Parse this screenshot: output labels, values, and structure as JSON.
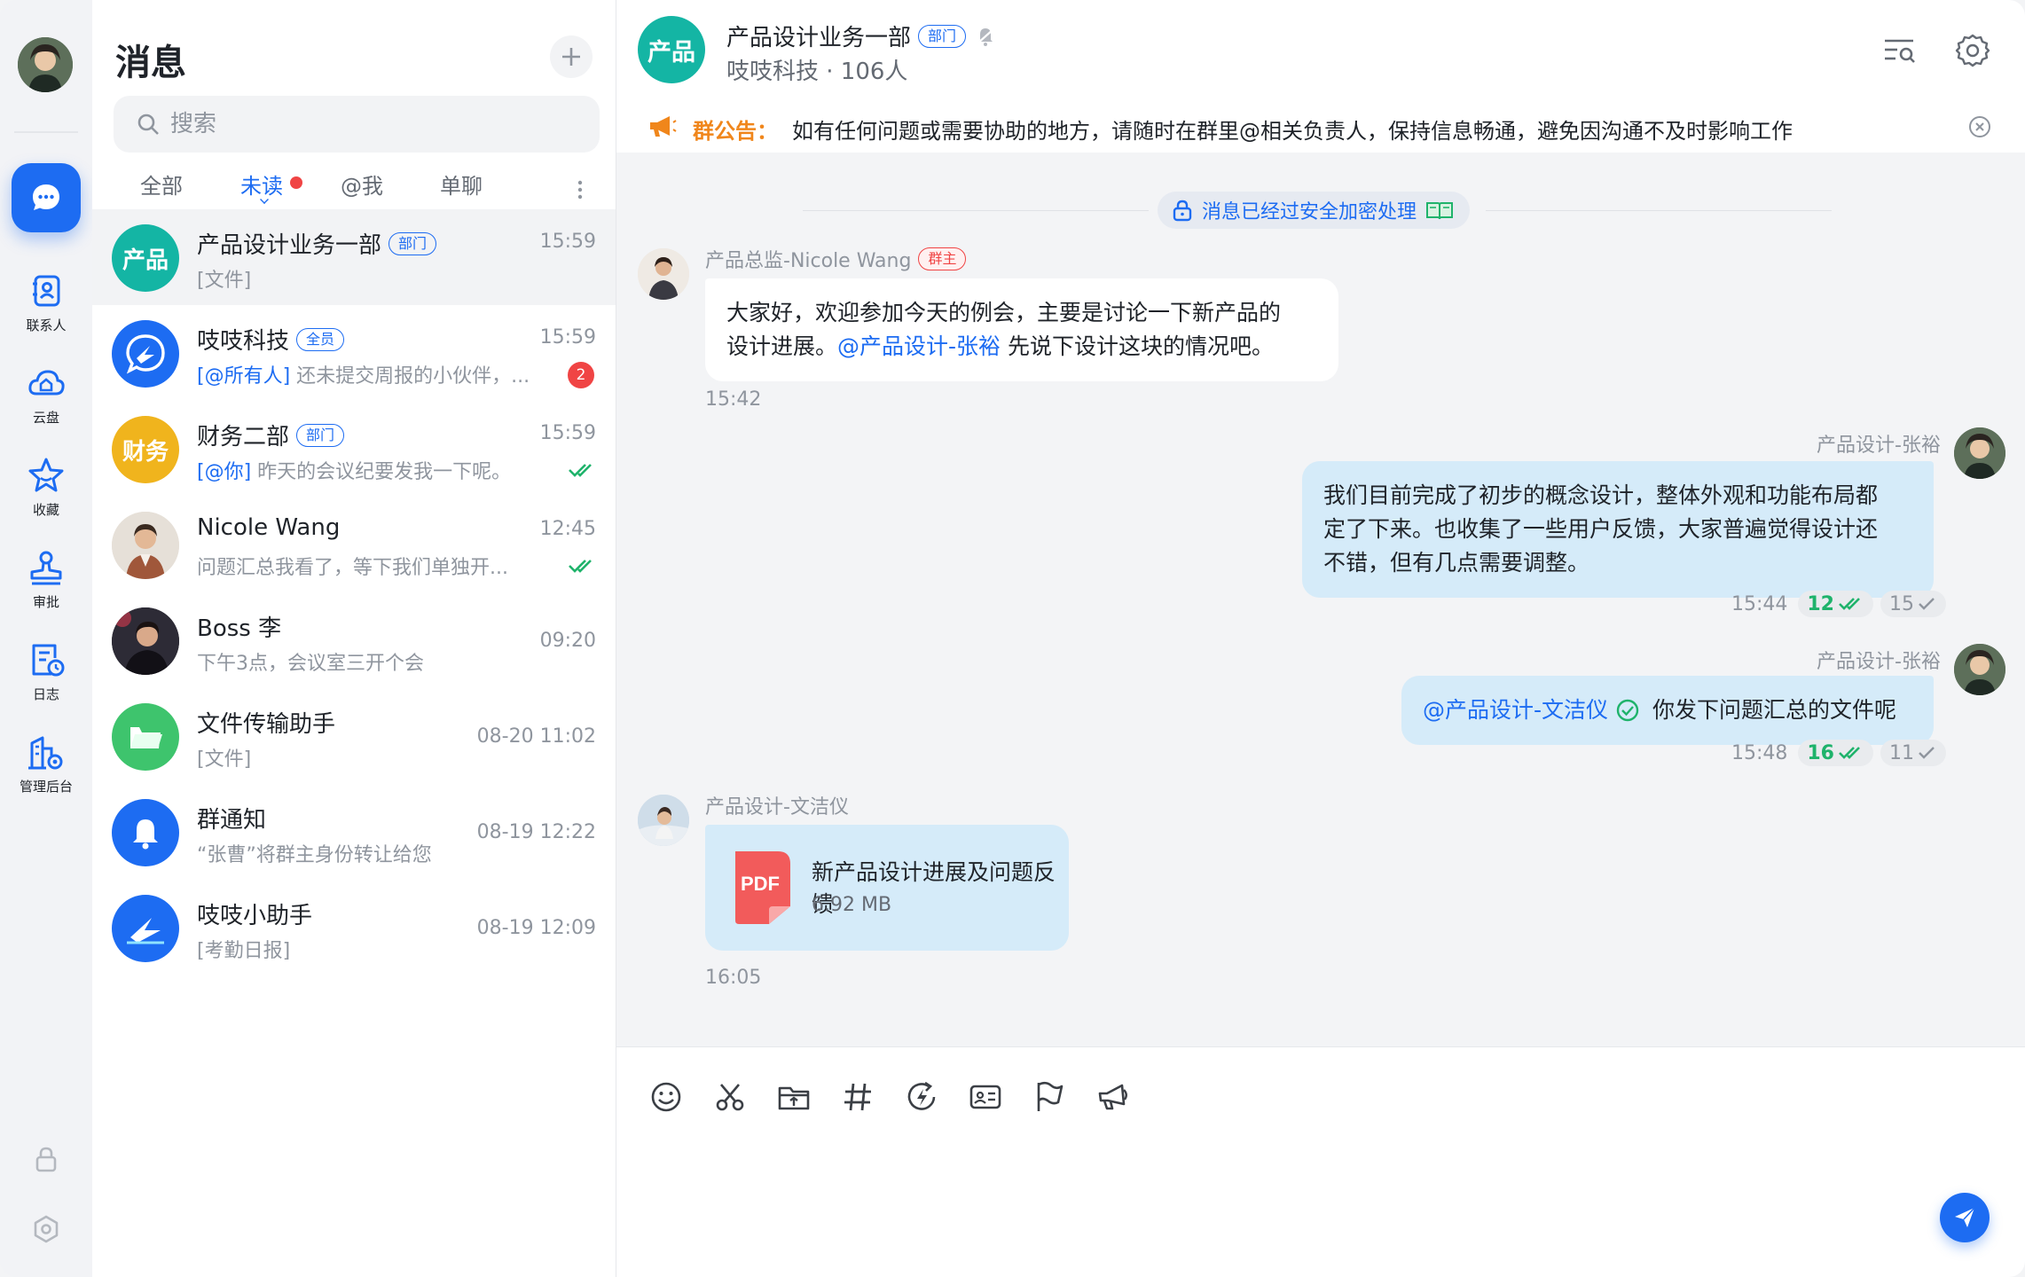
{
  "nav": {
    "items": [
      {
        "label": "联系人",
        "icon": "contacts-icon"
      },
      {
        "label": "云盘",
        "icon": "cloud-drive-icon"
      },
      {
        "label": "收藏",
        "icon": "star-icon"
      },
      {
        "label": "审批",
        "icon": "stamp-icon"
      },
      {
        "label": "日志",
        "icon": "log-icon"
      },
      {
        "label": "管理后台",
        "icon": "admin-icon"
      }
    ]
  },
  "list": {
    "title": "消息",
    "search_placeholder": "搜索",
    "tabs": [
      "全部",
      "未读",
      "@我",
      "单聊"
    ],
    "conversations": [
      {
        "name": "产品设计业务一部",
        "tag": "部门",
        "avatar_text": "产品",
        "avatar_color": "#14b5a4",
        "preview": "[文件]",
        "time": "15:59"
      },
      {
        "name": "吱吱科技",
        "tag": "全员",
        "avatar_color": "#1d6cf2",
        "preview_mention": "[@所有人]",
        "preview": "还未提交周报的小伙伴，...",
        "time": "15:59",
        "badge": "2"
      },
      {
        "name": "财务二部",
        "tag": "部门",
        "avatar_text": "财务",
        "avatar_color": "#f0b41d",
        "preview_mention": "[@你]",
        "preview": "昨天的会议纪要发我一下呢。",
        "time": "15:59"
      },
      {
        "name": "Nicole Wang",
        "preview": "问题汇总我看了，等下我们单独开...",
        "time": "12:45"
      },
      {
        "name": "Boss 李",
        "preview": "下午3点，会议室三开个会",
        "time": "09:20"
      },
      {
        "name": "文件传输助手",
        "avatar_color": "#3ec46d",
        "preview": "[文件]",
        "time": "08-20 11:02"
      },
      {
        "name": "群通知",
        "avatar_color": "#1d6cf2",
        "preview": "“张曹”将群主身份转让给您",
        "time": "08-19 12:22"
      },
      {
        "name": "吱吱小助手",
        "avatar_color": "#1d6cf2",
        "preview": "[考勤日报]",
        "time": "08-19 12:09"
      }
    ]
  },
  "chat": {
    "avatar_text": "产品",
    "title": "产品设计业务一部",
    "title_tag": "部门",
    "subtitle": "吱吱科技 · 106人",
    "notice_label": "群公告：",
    "notice_text": "如有任何问题或需要协助的地方，请随时在群里@相关负责人，保持信息畅通，避免因沟通不及时影响工作",
    "encryption_notice": "消息已经过安全加密处理",
    "messages": [
      {
        "sender": "产品总监-Nicole Wang",
        "sender_tag": "群主",
        "line1": "大家好，欢迎参加今天的例会，主要是讨论一下新产品的",
        "line2_a": "设计进展。",
        "line2_mention": "@产品设计-张裕",
        "line2_b": " 先说下设计这块的情况吧。",
        "time": "15:42"
      },
      {
        "sender": "产品设计-张裕",
        "lines": [
          "我们目前完成了初步的概念设计，整体外观和功能布局都",
          "定了下来。也收集了一些用户反馈，大家普遍觉得设计还",
          "不错，但有几点需要调整。"
        ],
        "time": "15:44",
        "read": "12",
        "unread": "15"
      },
      {
        "sender": "产品设计-张裕",
        "mention": "@产品设计-文洁仪",
        "text": "你发下问题汇总的文件呢",
        "time": "15:48",
        "read": "16",
        "unread": "11"
      },
      {
        "sender": "产品设计-文洁仪",
        "file_type": "PDF",
        "file_name": "新产品设计进展及问题反馈",
        "file_size": "6.92 MB",
        "time": "16:05"
      }
    ]
  },
  "colors": {
    "accent": "#1d6cf2",
    "notice": "#f0861b",
    "read": "#1fb36b",
    "badge": "#f04444",
    "outgoing_bubble": "#d5ebf9"
  }
}
